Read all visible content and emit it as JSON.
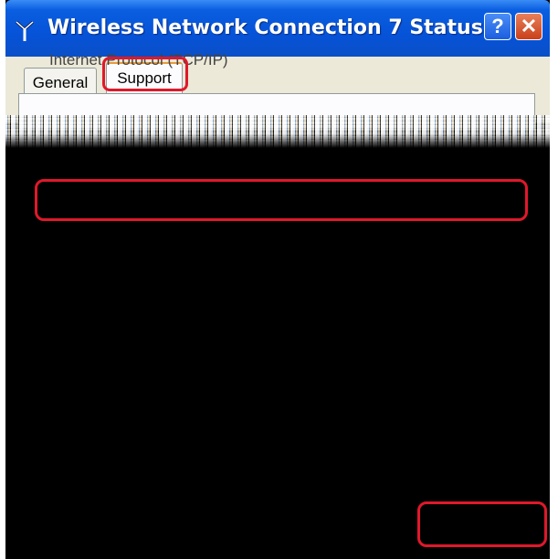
{
  "window": {
    "title": "Wireless Network Connection 7 Status",
    "icon": "antenna-icon",
    "help_label": "?",
    "close_label": "✕"
  },
  "tabs": [
    {
      "label": "General",
      "selected": false
    },
    {
      "label": "Support",
      "selected": true
    }
  ],
  "panel": {
    "partial_text": "Internet Protocol (TCP/IP)"
  },
  "colors": {
    "titlebar": "#0653d8",
    "dialog_background": "#ece9d8",
    "highlight": "#e0182a",
    "redacted": "#000000"
  }
}
